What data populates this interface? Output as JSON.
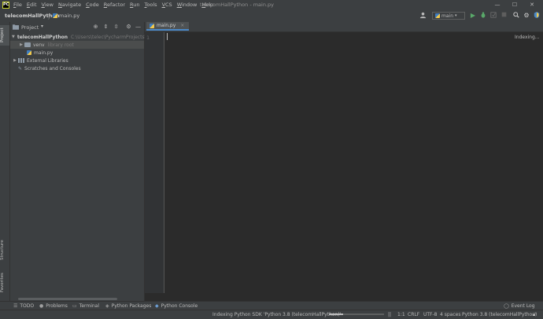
{
  "app": {
    "logo_text": "PC",
    "menu": [
      "File",
      "Edit",
      "View",
      "Navigate",
      "Code",
      "Refactor",
      "Run",
      "Tools",
      "VCS",
      "Window",
      "Help"
    ],
    "window_title": "telecomHallPython - main.py",
    "window_controls": {
      "minimize": "—",
      "maximize": "☐",
      "close": "✕"
    }
  },
  "navbar": {
    "project": "telecomHallPython",
    "separator": "〉",
    "file": "main.py",
    "run_config": "main",
    "icons": [
      "user-icon",
      "run-icon",
      "debug-icon",
      "coverage-icon",
      "stop-icon",
      "search-icon",
      "settings-icon",
      "update-icon"
    ]
  },
  "left_stripe": {
    "project_tab": "Project",
    "structure_tab": "Structure",
    "favorites_tab": "Favorites"
  },
  "project_panel": {
    "title": "Project",
    "tree": [
      {
        "label": "telecomHallPython",
        "extra": "C:\\Users\\telec\\PycharmProjects\\tele",
        "expanded": true,
        "bold": true
      },
      {
        "label": "venv",
        "extra": "library root",
        "expanded": false
      },
      {
        "label": "main.py",
        "extra": ""
      },
      {
        "label": "External Libraries",
        "extra": "",
        "expanded": false
      },
      {
        "label": "Scratches and Consoles",
        "extra": ""
      }
    ]
  },
  "editor": {
    "tab_label": "main.py",
    "tab_close": "×",
    "line_number": "1",
    "indexing_label": "Indexing..."
  },
  "bottom_toolbar": {
    "todo": "TODO",
    "problems": "Problems",
    "terminal": "Terminal",
    "python_packages": "Python Packages",
    "python_console": "Python Console",
    "event_log": "Event Log"
  },
  "status_bar": {
    "indexing": "Indexing Python SDK 'Python 3.8 (telecomHallPython)'",
    "pause": "||",
    "position": "1:1",
    "line_sep": "CRLF",
    "encoding": "UTF-8",
    "indent": "4 spaces",
    "interpreter": "Python 3.8 (telecomHallPython)",
    "progress": 0.25
  }
}
